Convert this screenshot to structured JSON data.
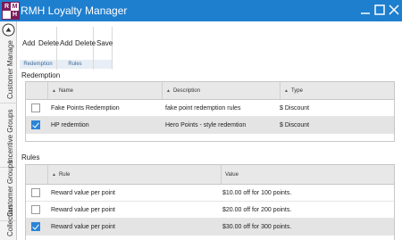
{
  "window": {
    "title": "RMH Loyalty Manager",
    "logo_letters": [
      "R",
      "M",
      "H"
    ]
  },
  "sidebar": {
    "tabs": [
      {
        "label": "Customer Manage"
      },
      {
        "label": "Incentive Groups"
      },
      {
        "label": "Customer Groups"
      },
      {
        "label": "Collection"
      }
    ]
  },
  "ribbon": {
    "groups": [
      {
        "label": "Redemption",
        "buttons": [
          "Add",
          "Delete"
        ]
      },
      {
        "label": "Rules",
        "buttons": [
          "Add",
          "Delete"
        ]
      },
      {
        "label": "",
        "buttons": [
          "Save"
        ]
      }
    ]
  },
  "redemption": {
    "section_label": "Redemption",
    "columns": [
      "Name",
      "Description",
      "Type"
    ],
    "rows": [
      {
        "checked": false,
        "name": "Fake Points Redemption",
        "description": "fake point redemption rules",
        "type": "$ Discount"
      },
      {
        "checked": true,
        "name": "HP redemtion",
        "description": "Hero Points - style redemtion",
        "type": "$ Discount"
      }
    ]
  },
  "rules": {
    "section_label": "Rules",
    "columns": [
      "Rule",
      "Value"
    ],
    "rows": [
      {
        "checked": false,
        "rule": "Reward value per point",
        "value": "$10.00 off for 100 points."
      },
      {
        "checked": false,
        "rule": "Reward value per point",
        "value": "$20.00 off for 200 points."
      },
      {
        "checked": true,
        "rule": "Reward value per point",
        "value": "$30.00 off for 300 points."
      }
    ]
  },
  "colors": {
    "titlebar": "#1f7fcf",
    "accent": "#2b84d6",
    "brand": "#7b1a5c"
  }
}
